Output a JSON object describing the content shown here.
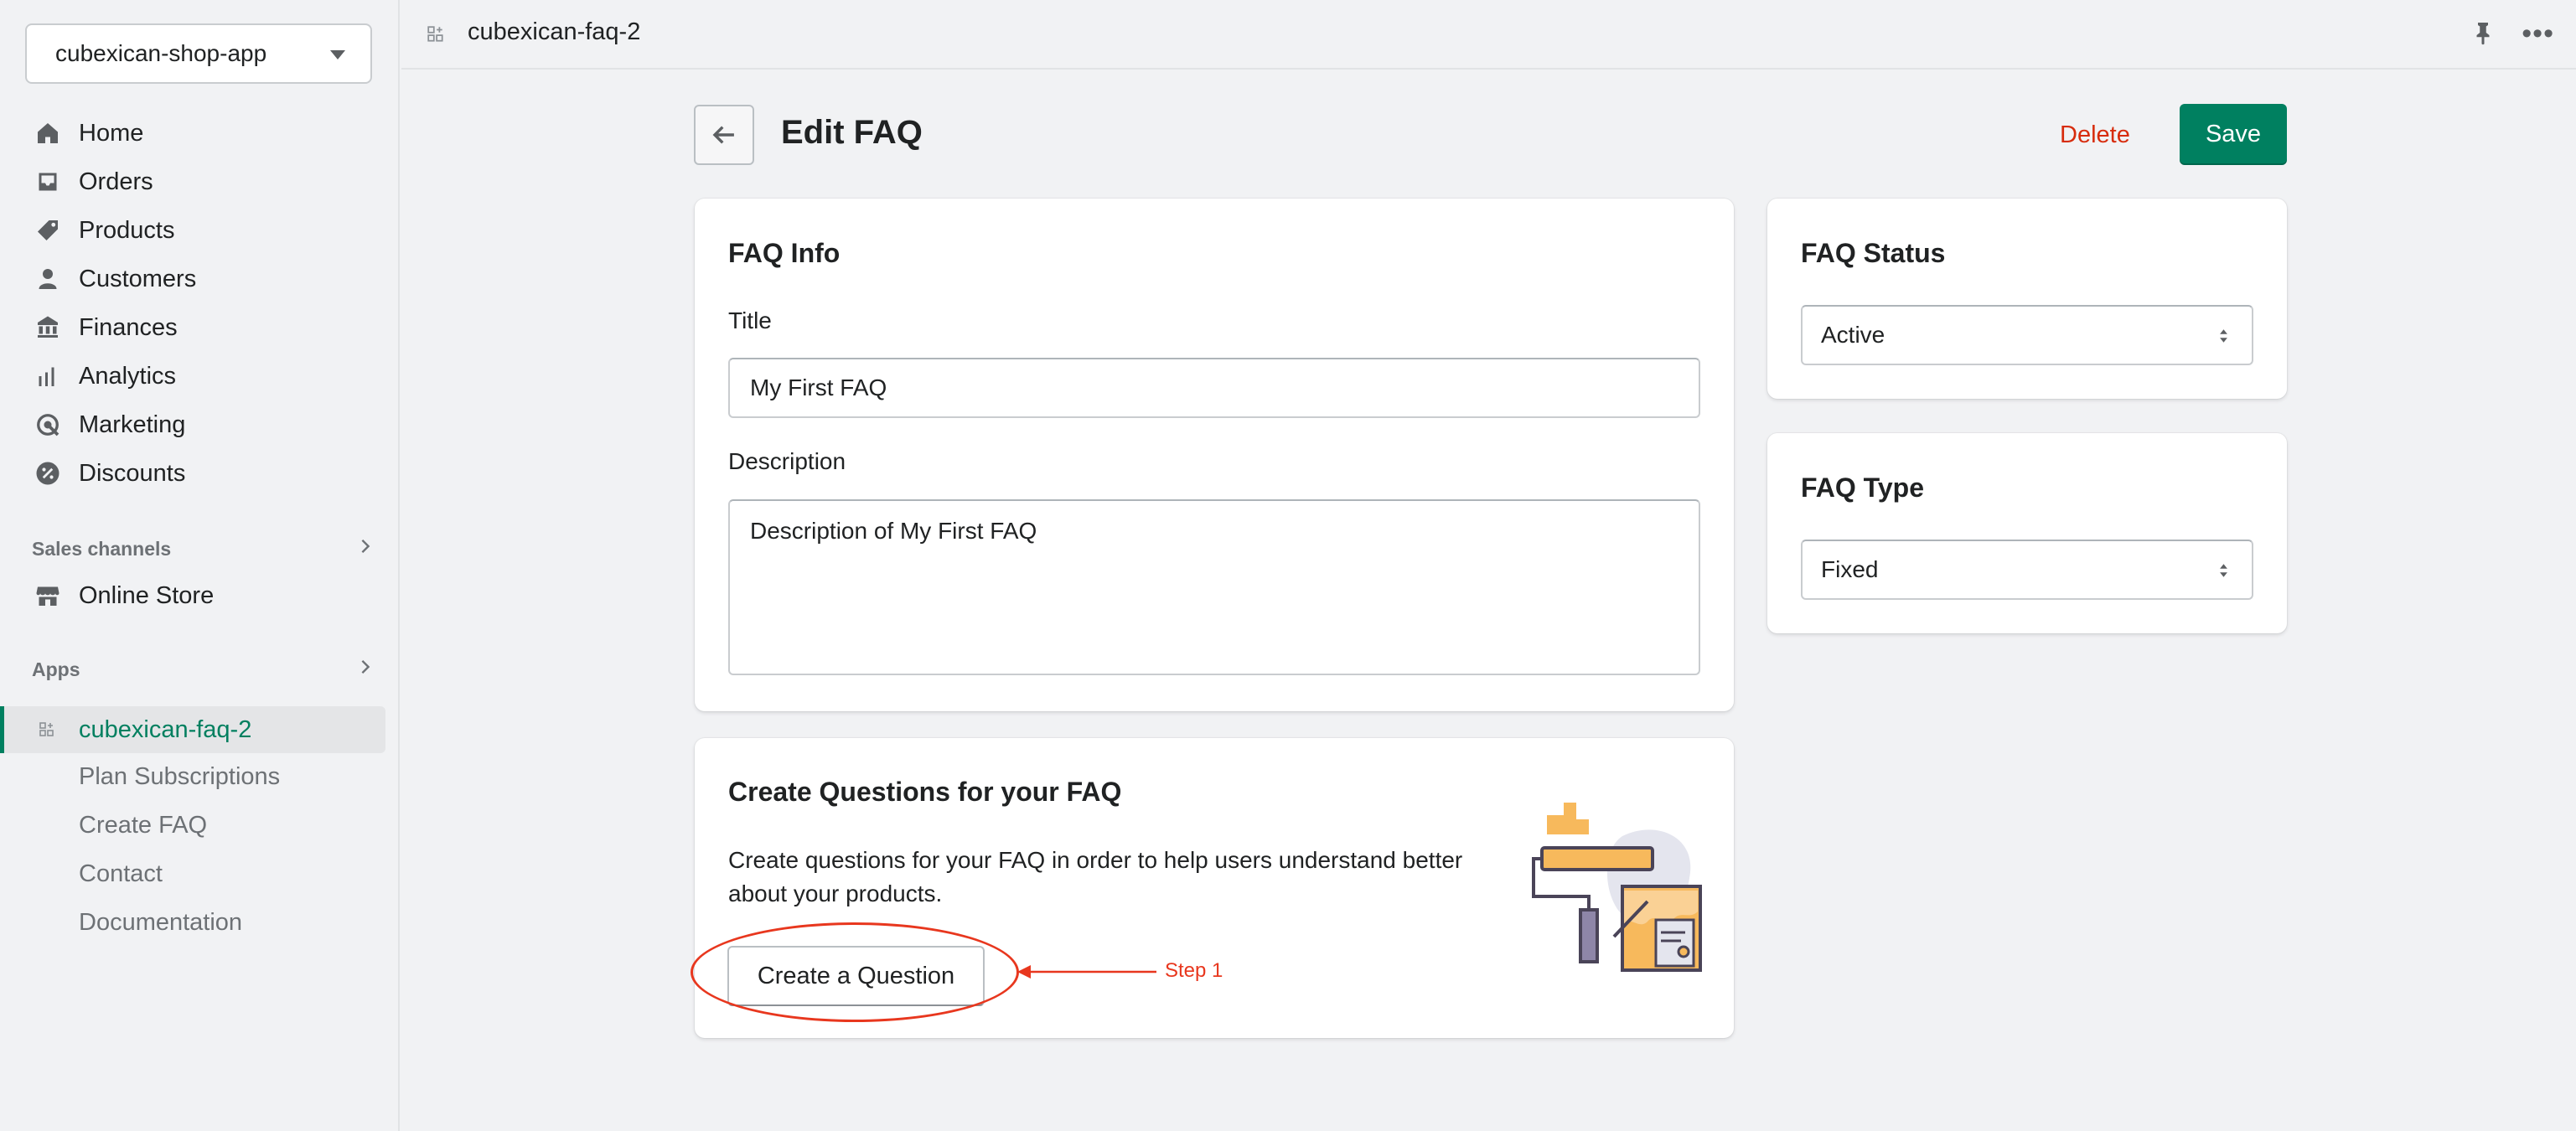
{
  "sidebar": {
    "store_name": "cubexican-shop-app",
    "nav": [
      {
        "label": "Home",
        "icon": "home-icon"
      },
      {
        "label": "Orders",
        "icon": "inbox-icon"
      },
      {
        "label": "Products",
        "icon": "tag-icon"
      },
      {
        "label": "Customers",
        "icon": "person-icon"
      },
      {
        "label": "Finances",
        "icon": "bank-icon"
      },
      {
        "label": "Analytics",
        "icon": "bar-chart-icon"
      },
      {
        "label": "Marketing",
        "icon": "target-icon"
      },
      {
        "label": "Discounts",
        "icon": "discount-icon"
      }
    ],
    "sales_channels_label": "Sales channels",
    "online_store_label": "Online Store",
    "apps_label": "Apps",
    "active_app": "cubexican-faq-2",
    "app_subitems": [
      "Plan Subscriptions",
      "Create FAQ",
      "Contact",
      "Documentation"
    ]
  },
  "topbar": {
    "title": "cubexican-faq-2"
  },
  "page": {
    "title": "Edit FAQ",
    "delete_label": "Delete",
    "save_label": "Save"
  },
  "faq_info": {
    "heading": "FAQ Info",
    "title_label": "Title",
    "title_value": "My First FAQ",
    "description_label": "Description",
    "description_value": "Description of My First FAQ"
  },
  "faq_status": {
    "heading": "FAQ Status",
    "selected": "Active"
  },
  "faq_type": {
    "heading": "FAQ Type",
    "selected": "Fixed"
  },
  "questions": {
    "heading": "Create Questions for your FAQ",
    "body_line1": "Create questions for your FAQ in order to help users understand better",
    "body_line2": "about your products.",
    "button_label": "Create a Question"
  },
  "annotation": {
    "step_label": "Step 1"
  },
  "colors": {
    "primary": "#008060",
    "critical": "#d72c0d",
    "annotation": "#e8371e",
    "active_nav_text": "#007f5f"
  }
}
